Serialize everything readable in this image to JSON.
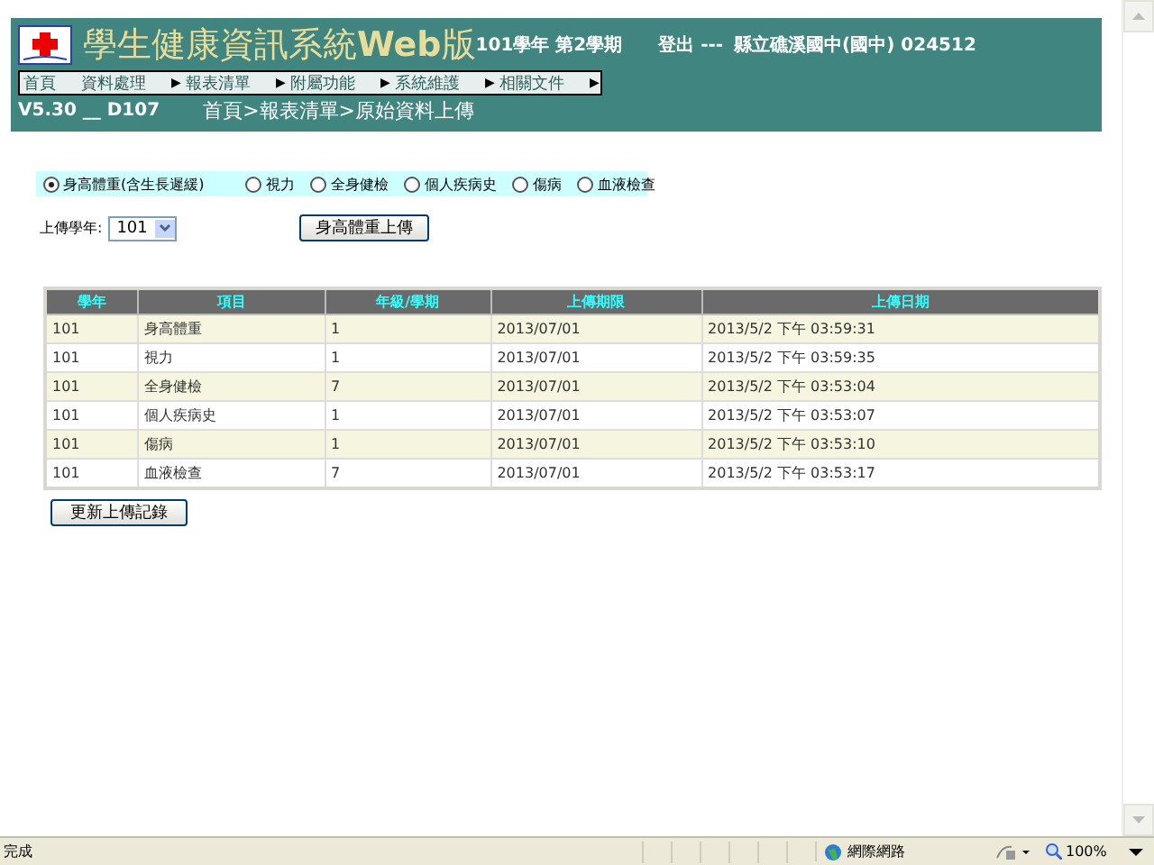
{
  "header": {
    "title": "學生健康資訊系統**Web**版",
    "term": "101學年 第2學期",
    "logout": "登出 ---",
    "school": "縣立礁溪國中(國中) 024512"
  },
  "menu": [
    {
      "label": "首頁",
      "submenu": false
    },
    {
      "label": "資料處理",
      "submenu": true
    },
    {
      "label": "報表清單",
      "submenu": true
    },
    {
      "label": "附屬功能",
      "submenu": true
    },
    {
      "label": "系統維護",
      "submenu": true
    },
    {
      "label": "相關文件",
      "submenu": true
    }
  ],
  "arrow": "▶",
  "version": "V5.30 __ D107",
  "breadcrumb": "首頁>報表清單>原始資料上傳",
  "options": [
    {
      "label": "身高體重(含生長遲緩)",
      "selected": true
    },
    {
      "label": "視力",
      "selected": false
    },
    {
      "label": "全身健檢",
      "selected": false
    },
    {
      "label": "個人疾病史",
      "selected": false
    },
    {
      "label": "傷病",
      "selected": false
    },
    {
      "label": "血液檢查",
      "selected": false
    }
  ],
  "year_label": "上傳學年:",
  "year_value": "101",
  "upload_button": "身高體重上傳",
  "table": {
    "columns": [
      "學年",
      "項目",
      "年級/學期",
      "上傳期限",
      "上傳日期"
    ],
    "rows": [
      [
        "101",
        "身高體重",
        "1",
        "2013/07/01",
        "2013/5/2 下午 03:59:31"
      ],
      [
        "101",
        "視力",
        "1",
        "2013/07/01",
        "2013/5/2 下午 03:59:35"
      ],
      [
        "101",
        "全身健檢",
        "7",
        "2013/07/01",
        "2013/5/2 下午 03:53:04"
      ],
      [
        "101",
        "個人疾病史",
        "1",
        "2013/07/01",
        "2013/5/2 下午 03:53:07"
      ],
      [
        "101",
        "傷病",
        "1",
        "2013/07/01",
        "2013/5/2 下午 03:53:10"
      ],
      [
        "101",
        "血液檢查",
        "7",
        "2013/07/01",
        "2013/5/2 下午 03:53:17"
      ]
    ]
  },
  "refresh_button": "更新上傳記錄",
  "status": {
    "text": "完成",
    "zone": "網際網路",
    "zoom": "100%"
  }
}
